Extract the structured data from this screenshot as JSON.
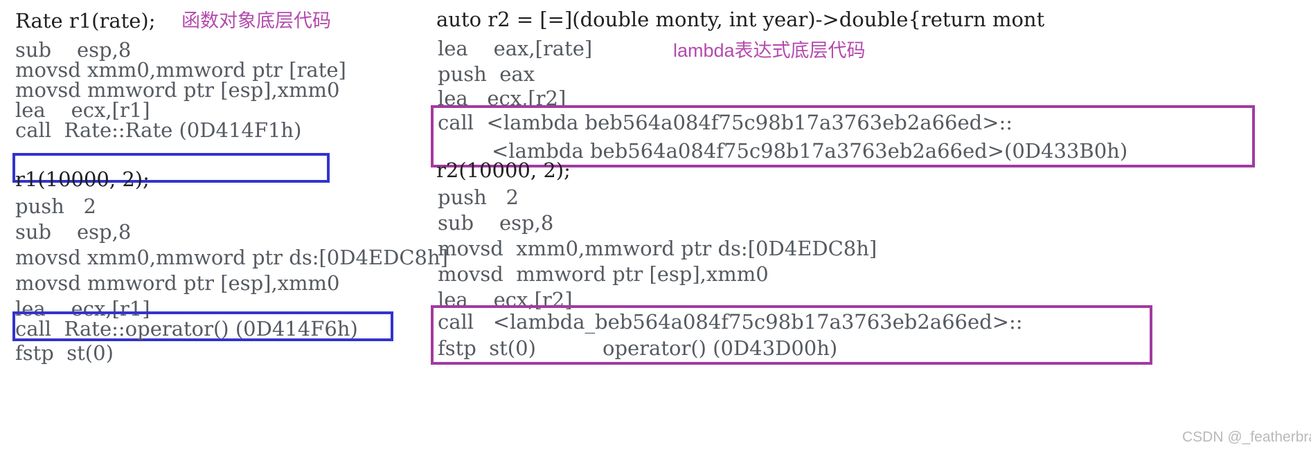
{
  "page": {
    "watermark": "CSDN @_featherbrain",
    "colors": {
      "box_blue": "#3333cc",
      "box_purple": "#a23ba0",
      "annotation_purple": "#b44aad",
      "code_text": "#555a60",
      "source_text": "#202020",
      "background": "#ffffff"
    }
  },
  "left_column": {
    "annotation": "函数对象底层代码",
    "block1": {
      "source_line": "Rate r1(rate);",
      "asm_lines": [
        "sub    esp,8",
        "movsd xmm0,mmword ptr [rate]",
        "movsd mmword ptr [esp],xmm0",
        "lea    ecx,[r1]"
      ],
      "highlighted_line": "call  Rate::Rate (0D414F1h)"
    },
    "block2": {
      "source_line": "r1(10000, 2);",
      "asm_lines": [
        "push   2",
        "sub    esp,8",
        "movsd xmm0,mmword ptr ds:[0D4EDC8h]",
        "movsd mmword ptr [esp],xmm0",
        "lea    ecx,[r1]"
      ],
      "highlighted_line": "call  Rate::operator() (0D414F6h)",
      "trailing_line": "fstp  st(0)"
    }
  },
  "right_column": {
    "annotation": "lambda表达式底层代码",
    "block1": {
      "source_line": "auto r2 = [=](double monty, int year)->double{return mont",
      "asm_lines": [
        "lea    eax,[rate]",
        "push  eax",
        "lea   ecx,[r2]"
      ],
      "highlighted_line_1": "call  <lambda beb564a084f75c98b17a3763eb2a66ed>::",
      "highlighted_line_2": "<lambda beb564a084f75c98b17a3763eb2a66ed>(0D433B0h)"
    },
    "block2": {
      "source_line": "r2(10000, 2);",
      "asm_lines": [
        "push   2",
        "sub    esp,8",
        "movsd  xmm0,mmword ptr ds:[0D4EDC8h]",
        "movsd  mmword ptr [esp],xmm0",
        "lea    ecx,[r2]"
      ],
      "highlighted_line_1": "call   <lambda_beb564a084f75c98b17a3763eb2a66ed>::",
      "highlighted_line_2": "operator() (0D43D00h)",
      "overlap_line": "fstp  st(0)"
    }
  }
}
